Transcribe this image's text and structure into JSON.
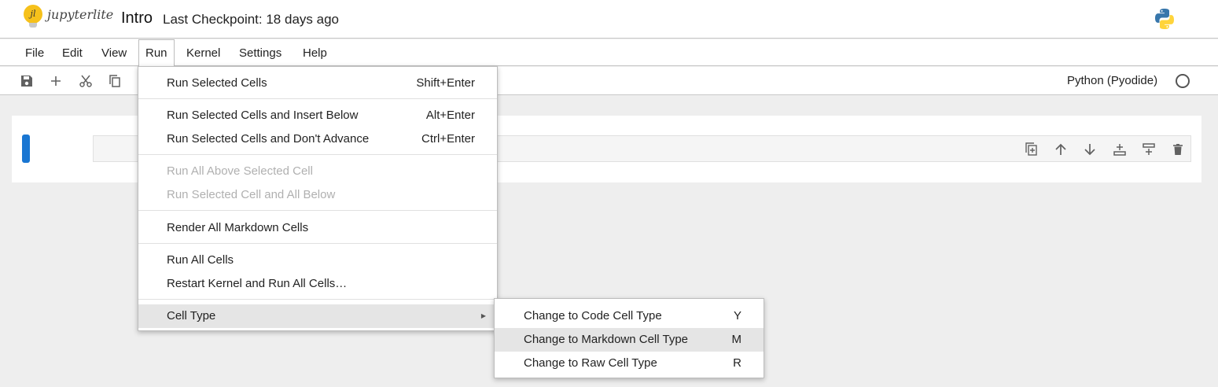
{
  "topbar": {
    "logo_mark": "jl",
    "logo_text": "jupyterlite",
    "notebook_title": "Intro",
    "checkpoint": "Last Checkpoint: 18 days ago"
  },
  "menubar": {
    "items": [
      "File",
      "Edit",
      "View",
      "Run",
      "Kernel",
      "Settings",
      "Help"
    ],
    "active": "Run"
  },
  "toolbar": {
    "kernel_name": "Python (Pyodide)",
    "kernel_status": "idle"
  },
  "run_menu": {
    "items": [
      {
        "label": "Run Selected Cells",
        "shortcut": "Shift+Enter"
      },
      {
        "label": "Run Selected Cells and Insert Below",
        "shortcut": "Alt+Enter"
      },
      {
        "label": "Run Selected Cells and Don't Advance",
        "shortcut": "Ctrl+Enter"
      },
      {
        "label": "Run All Above Selected Cell"
      },
      {
        "label": "Run Selected Cell and All Below"
      },
      {
        "label": "Render All Markdown Cells"
      },
      {
        "label": "Run All Cells"
      },
      {
        "label": "Restart Kernel and Run All Cells…"
      },
      {
        "label": "Cell Type"
      }
    ]
  },
  "cell_type_submenu": {
    "items": [
      {
        "label": "Change to Code Cell Type",
        "shortcut": "Y"
      },
      {
        "label": "Change to Markdown Cell Type",
        "shortcut": "M"
      },
      {
        "label": "Change to Raw Cell Type",
        "shortcut": "R"
      }
    ]
  },
  "colors": {
    "accent": "#1976d2",
    "logo": "#f6c11b",
    "menu_hover": "#e5e5e5",
    "disabled_text": "#b0b0b0"
  }
}
